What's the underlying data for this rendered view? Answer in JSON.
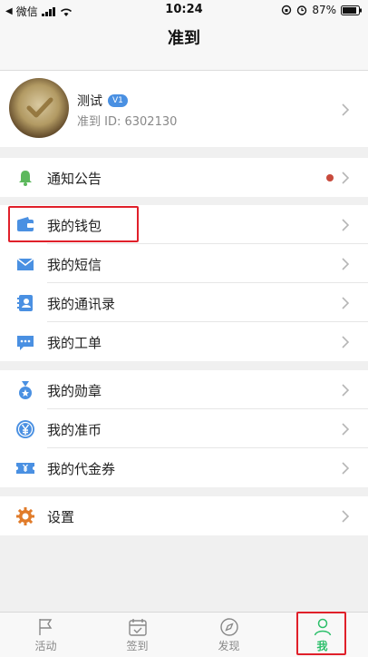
{
  "status_bar": {
    "carrier": "微信",
    "time": "10:24",
    "battery": "87%"
  },
  "header": {
    "title": "准到"
  },
  "profile": {
    "name": "测试",
    "level": "V1",
    "id_text": "准到 ID: 6302130"
  },
  "menu": {
    "notice": {
      "label": "通知公告",
      "icon": "bell-icon",
      "color": "#5cb85c",
      "unread": true
    },
    "wallet": {
      "label": "我的钱包",
      "icon": "wallet-icon",
      "color": "#4a90e2"
    },
    "messages": {
      "label": "我的短信",
      "icon": "envelope-icon",
      "color": "#4a90e2"
    },
    "contacts": {
      "label": "我的通讯录",
      "icon": "contacts-icon",
      "color": "#4a90e2"
    },
    "tickets": {
      "label": "我的工单",
      "icon": "chat-icon",
      "color": "#4a90e2"
    },
    "medals": {
      "label": "我的勋章",
      "icon": "medal-icon",
      "color": "#4a90e2"
    },
    "coins": {
      "label": "我的准币",
      "icon": "yen-coin-icon",
      "color": "#4a90e2"
    },
    "vouchers": {
      "label": "我的代金券",
      "icon": "voucher-icon",
      "color": "#4a90e2"
    },
    "settings": {
      "label": "设置",
      "icon": "gear-icon",
      "color": "#e07b2a"
    }
  },
  "tabbar": {
    "tabs": [
      {
        "label": "活动",
        "icon": "flag-icon"
      },
      {
        "label": "签到",
        "icon": "calendar-check-icon"
      },
      {
        "label": "发现",
        "icon": "compass-icon"
      },
      {
        "label": "我",
        "icon": "person-icon",
        "active": true
      }
    ],
    "active_color": "#2cbf6a"
  }
}
